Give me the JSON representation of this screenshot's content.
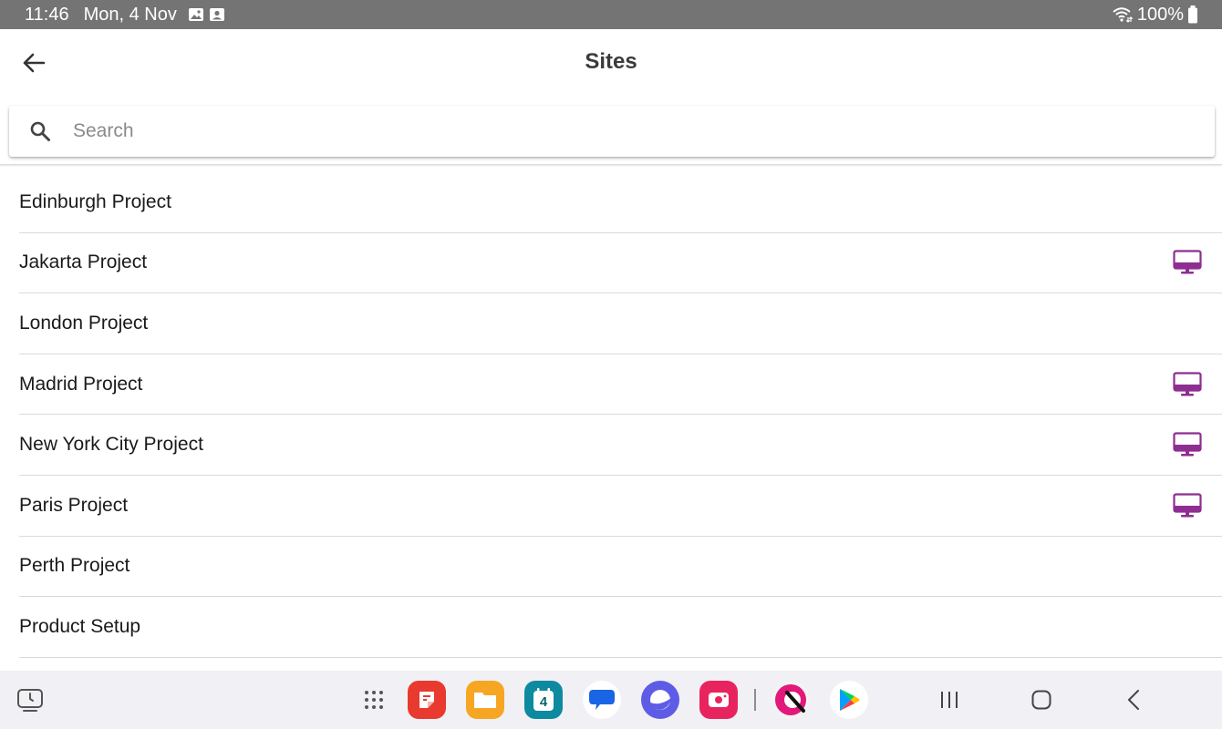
{
  "status_bar": {
    "time": "11:46",
    "date": "Mon, 4 Nov",
    "battery": "100%",
    "icons": [
      "gallery-icon",
      "contact-card-icon",
      "wifi-icon",
      "battery-icon"
    ]
  },
  "header": {
    "title": "Sites",
    "back_icon": "arrow-left-icon"
  },
  "search": {
    "placeholder": "Search",
    "value": "",
    "icon": "search-icon"
  },
  "sites": [
    {
      "name": "Edinburgh Project",
      "has_device": false
    },
    {
      "name": "Jakarta Project",
      "has_device": true
    },
    {
      "name": "London Project",
      "has_device": false
    },
    {
      "name": "Madrid Project",
      "has_device": true
    },
    {
      "name": "New York City Project",
      "has_device": true
    },
    {
      "name": "Paris Project",
      "has_device": true
    },
    {
      "name": "Perth Project",
      "has_device": false
    },
    {
      "name": "Product Setup",
      "has_device": false
    }
  ],
  "colors": {
    "status_bar": "#747474",
    "device_icon": "#8e2e91",
    "divider": "#dadada",
    "navbar": "#f1f1f5"
  },
  "navbar": {
    "icons": [
      "taskbar-toggle-icon",
      "app-drawer-icon",
      "notes-app-icon",
      "my-files-app-icon",
      "calendar-app-icon",
      "messages-app-icon",
      "internet-app-icon",
      "screen-recorder-app-icon",
      "sketch-app-icon",
      "play-store-app-icon",
      "recents-icon",
      "home-icon",
      "back-nav-icon"
    ],
    "calendar_day": "4"
  }
}
